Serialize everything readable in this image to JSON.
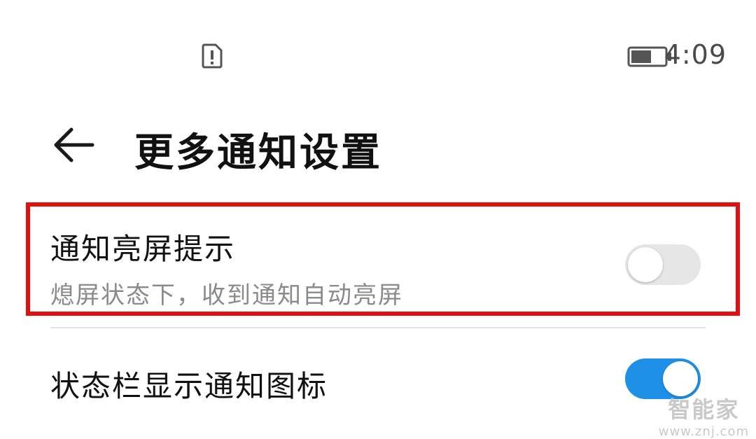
{
  "status_bar": {
    "time": "4:09",
    "sim_icon": "sim-alert-icon",
    "battery_icon": "battery-icon",
    "battery_level": 0.55
  },
  "header": {
    "back_icon": "arrow-left-icon",
    "title": "更多通知设置"
  },
  "settings": [
    {
      "title": "通知亮屏提示",
      "description": "熄屏状态下，收到通知自动亮屏",
      "enabled": false
    },
    {
      "title": "状态栏显示通知图标",
      "enabled": true
    }
  ],
  "colors": {
    "highlight": "#e01010",
    "toggle_on": "#1e90e8",
    "toggle_off": "#e6e6e6"
  },
  "watermark": {
    "text": "智能家",
    "url": "www.znj.com"
  }
}
